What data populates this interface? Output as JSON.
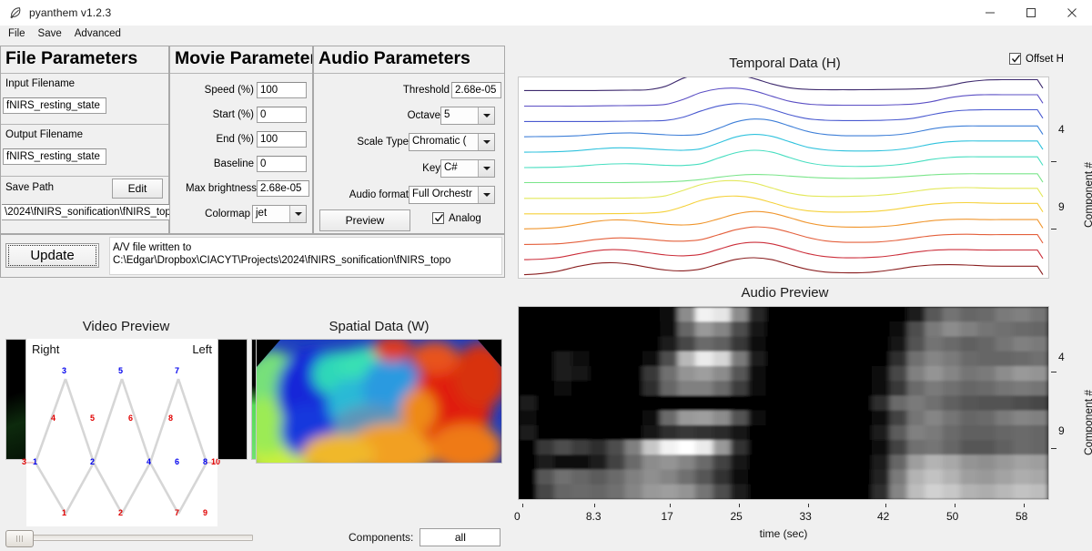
{
  "window": {
    "title": "pyanthem v1.2.3",
    "app_icon": "feather-icon",
    "minimize": "minimize-icon",
    "maximize": "maximize-icon",
    "close": "close-icon"
  },
  "menubar": {
    "items": [
      "File",
      "Save",
      "Advanced"
    ]
  },
  "file_parameters": {
    "header": "File Parameters",
    "input_filename_label": "Input Filename",
    "input_filename_value": "fNIRS_resting_state",
    "output_filename_label": "Output Filename",
    "output_filename_value": "fNIRS_resting_state",
    "save_path_label": "Save Path",
    "edit_button": "Edit",
    "save_path_value": "\\2024\\fNIRS_sonification\\fNIRS_topo"
  },
  "movie_parameters": {
    "header": "Movie Parameters",
    "rows": [
      {
        "label": "Speed (%)",
        "value": "100"
      },
      {
        "label": "Start (%)",
        "value": "0"
      },
      {
        "label": "End (%)",
        "value": "100"
      },
      {
        "label": "Baseline",
        "value": "0"
      },
      {
        "label": "Max brightness",
        "value": "2.68e-05"
      }
    ],
    "colormap_label": "Colormap",
    "colormap_value": "jet"
  },
  "audio_parameters": {
    "header": "Audio Parameters",
    "threshold_label": "Threshold",
    "threshold_value": "2.68e-05",
    "octave_label": "Octave",
    "octave_value": "5",
    "scale_type_label": "Scale Type",
    "scale_type_value": "Chromatic (",
    "key_label": "Key",
    "key_value": "C#",
    "audio_format_label": "Audio format",
    "audio_format_value": "Full Orchestr",
    "preview_button": "Preview",
    "analog_label": "Analog",
    "analog_checked": true
  },
  "action_bar": {
    "update_button": "Update",
    "status_line1": "A/V file written to",
    "status_line2": "C:\\Edgar\\Dropbox\\CIACYT\\Projects\\2024\\fNIRS_sonification\\fNIRS_topo"
  },
  "video_preview": {
    "title": "Video Preview",
    "right_label": "Right",
    "left_label": "Left",
    "source_nodes": [
      "1",
      "2",
      "3",
      "4",
      "5",
      "6",
      "7",
      "8"
    ],
    "detector_nodes": [
      "1",
      "2",
      "3",
      "4",
      "5",
      "6",
      "7",
      "8",
      "9",
      "10"
    ],
    "source_color": "#0000ee",
    "detector_color": "#e00000",
    "timeline_value": 0
  },
  "spatial_data": {
    "title": "Spatial Data (W)"
  },
  "components_selector": {
    "label": "Components:",
    "value": "all"
  },
  "temporal_plot": {
    "title": "Temporal Data (H)",
    "offset_label": "Offset H",
    "offset_checked": true
  },
  "audio_plot": {
    "title": "Audio Preview"
  },
  "chart_data": [
    {
      "type": "line",
      "title": "Temporal Data (H)",
      "xlabel": "",
      "ylabel": "Component #",
      "yticks": [
        4,
        9
      ],
      "ylim": [
        1,
        13
      ],
      "grid": false,
      "legend": "none",
      "colormap": "jet",
      "n_series": 13,
      "series": [
        {
          "name": "Component 1",
          "color": "#3e2a6e",
          "values": [
            0.08,
            0.08,
            0.08,
            0.08,
            0.08,
            0.09,
            0.1,
            0.12,
            0.3,
            0.72,
            0.95,
            1.0,
            0.92,
            0.7,
            0.42,
            0.22,
            0.14,
            0.12,
            0.12,
            0.12,
            0.13,
            0.14,
            0.16,
            0.2,
            0.34,
            0.52,
            0.62,
            0.64,
            0.64,
            0.64
          ]
        },
        {
          "name": "Component 2",
          "color": "#5b4fc4",
          "values": [
            0.07,
            0.07,
            0.07,
            0.07,
            0.08,
            0.09,
            0.1,
            0.11,
            0.16,
            0.42,
            0.78,
            0.97,
            1.0,
            0.86,
            0.58,
            0.32,
            0.18,
            0.13,
            0.12,
            0.12,
            0.12,
            0.14,
            0.18,
            0.3,
            0.5,
            0.62,
            0.66,
            0.66,
            0.66,
            0.66
          ]
        },
        {
          "name": "Component 3",
          "color": "#4a5ad0",
          "values": [
            0.07,
            0.07,
            0.07,
            0.07,
            0.07,
            0.08,
            0.09,
            0.1,
            0.13,
            0.3,
            0.62,
            0.88,
            1.0,
            0.94,
            0.7,
            0.42,
            0.22,
            0.14,
            0.12,
            0.12,
            0.13,
            0.16,
            0.24,
            0.42,
            0.58,
            0.66,
            0.68,
            0.68,
            0.68,
            0.68
          ]
        },
        {
          "name": "Component 4",
          "color": "#3e7fd8",
          "values": [
            0.08,
            0.09,
            0.1,
            0.13,
            0.2,
            0.26,
            0.28,
            0.24,
            0.18,
            0.16,
            0.22,
            0.52,
            0.86,
            1.0,
            0.92,
            0.64,
            0.36,
            0.2,
            0.14,
            0.13,
            0.14,
            0.18,
            0.3,
            0.48,
            0.6,
            0.64,
            0.64,
            0.64,
            0.64,
            0.64
          ]
        },
        {
          "name": "Component 5",
          "color": "#2fc2dd",
          "values": [
            0.08,
            0.09,
            0.11,
            0.16,
            0.24,
            0.3,
            0.3,
            0.26,
            0.2,
            0.18,
            0.26,
            0.56,
            0.88,
            1.0,
            0.9,
            0.62,
            0.34,
            0.2,
            0.15,
            0.14,
            0.15,
            0.2,
            0.32,
            0.5,
            0.62,
            0.66,
            0.66,
            0.66,
            0.66,
            0.66
          ]
        },
        {
          "name": "Component 6",
          "color": "#47dec0",
          "values": [
            0.08,
            0.09,
            0.11,
            0.15,
            0.22,
            0.27,
            0.28,
            0.25,
            0.2,
            0.19,
            0.28,
            0.58,
            0.86,
            0.98,
            0.88,
            0.6,
            0.34,
            0.2,
            0.15,
            0.14,
            0.16,
            0.22,
            0.34,
            0.5,
            0.6,
            0.64,
            0.64,
            0.64,
            0.64,
            0.64
          ]
        },
        {
          "name": "Component 7",
          "color": "#7ae58a",
          "values": [
            0.1,
            0.1,
            0.1,
            0.1,
            0.1,
            0.1,
            0.11,
            0.12,
            0.14,
            0.18,
            0.26,
            0.38,
            0.48,
            0.52,
            0.5,
            0.44,
            0.38,
            0.34,
            0.32,
            0.32,
            0.34,
            0.38,
            0.44,
            0.5,
            0.54,
            0.56,
            0.56,
            0.56,
            0.56,
            0.56
          ]
        },
        {
          "name": "Component 8",
          "color": "#e3e85a",
          "values": [
            0.08,
            0.08,
            0.08,
            0.08,
            0.08,
            0.09,
            0.1,
            0.12,
            0.22,
            0.5,
            0.8,
            0.97,
            1.0,
            0.88,
            0.62,
            0.36,
            0.22,
            0.18,
            0.18,
            0.2,
            0.24,
            0.32,
            0.44,
            0.56,
            0.62,
            0.64,
            0.62,
            0.6,
            0.6,
            0.6
          ]
        },
        {
          "name": "Component 9",
          "color": "#f5d13a",
          "values": [
            0.08,
            0.08,
            0.08,
            0.08,
            0.08,
            0.09,
            0.1,
            0.12,
            0.2,
            0.46,
            0.78,
            0.96,
            1.0,
            0.9,
            0.66,
            0.4,
            0.24,
            0.18,
            0.17,
            0.18,
            0.22,
            0.32,
            0.46,
            0.58,
            0.64,
            0.66,
            0.64,
            0.62,
            0.62,
            0.62
          ]
        },
        {
          "name": "Component 10",
          "color": "#f0962e",
          "values": [
            0.1,
            0.12,
            0.18,
            0.32,
            0.48,
            0.56,
            0.54,
            0.44,
            0.34,
            0.3,
            0.38,
            0.62,
            0.88,
            1.0,
            0.92,
            0.68,
            0.42,
            0.26,
            0.2,
            0.19,
            0.21,
            0.28,
            0.4,
            0.52,
            0.58,
            0.6,
            0.58,
            0.58,
            0.58,
            0.58
          ]
        },
        {
          "name": "Component 11",
          "color": "#e4603c",
          "values": [
            0.09,
            0.1,
            0.13,
            0.22,
            0.34,
            0.42,
            0.42,
            0.36,
            0.28,
            0.26,
            0.34,
            0.6,
            0.86,
            1.0,
            0.94,
            0.72,
            0.46,
            0.28,
            0.21,
            0.2,
            0.22,
            0.3,
            0.42,
            0.54,
            0.6,
            0.62,
            0.6,
            0.6,
            0.6,
            0.6
          ]
        },
        {
          "name": "Component 12",
          "color": "#cc2f3b",
          "values": [
            0.1,
            0.13,
            0.22,
            0.4,
            0.56,
            0.62,
            0.58,
            0.46,
            0.34,
            0.3,
            0.38,
            0.64,
            0.9,
            1.0,
            0.92,
            0.68,
            0.42,
            0.26,
            0.2,
            0.2,
            0.24,
            0.34,
            0.48,
            0.58,
            0.62,
            0.62,
            0.6,
            0.6,
            0.6,
            0.6
          ]
        },
        {
          "name": "Component 13",
          "color": "#8a1f20",
          "values": [
            0.12,
            0.18,
            0.32,
            0.54,
            0.7,
            0.74,
            0.66,
            0.5,
            0.36,
            0.32,
            0.42,
            0.68,
            0.92,
            1.0,
            0.9,
            0.64,
            0.4,
            0.26,
            0.22,
            0.22,
            0.28,
            0.4,
            0.54,
            0.62,
            0.64,
            0.62,
            0.58,
            0.56,
            0.56,
            0.56
          ]
        }
      ]
    },
    {
      "type": "heatmap",
      "title": "Audio Preview",
      "xlabel": "time (sec)",
      "ylabel": "Component #",
      "xticks": [
        "0",
        "8.3",
        "17",
        "25",
        "33",
        "42",
        "50",
        "58"
      ],
      "xtick_positions": [
        0,
        8.3,
        17,
        25,
        33,
        42,
        50,
        58
      ],
      "yticks": [
        4,
        9
      ],
      "xlim": [
        0,
        60
      ],
      "ylim": [
        1,
        13
      ],
      "colormap": "gray",
      "rows": 13,
      "cols": 30,
      "matrix": [
        [
          0,
          0,
          0,
          0,
          0,
          0,
          0,
          0,
          0.05,
          0.55,
          0.95,
          0.9,
          0.55,
          0.15,
          0.02,
          0,
          0,
          0,
          0,
          0,
          0,
          0,
          0.1,
          0.35,
          0.45,
          0.4,
          0.42,
          0.48,
          0.5,
          0.46
        ],
        [
          0,
          0,
          0,
          0,
          0,
          0,
          0,
          0,
          0.04,
          0.4,
          0.6,
          0.52,
          0.3,
          0.08,
          0,
          0,
          0,
          0,
          0,
          0,
          0,
          0.05,
          0.3,
          0.48,
          0.55,
          0.5,
          0.46,
          0.44,
          0.42,
          0.4
        ],
        [
          0,
          0,
          0,
          0,
          0,
          0,
          0,
          0.02,
          0.1,
          0.28,
          0.42,
          0.38,
          0.22,
          0.05,
          0,
          0,
          0,
          0,
          0,
          0,
          0,
          0.08,
          0.32,
          0.45,
          0.42,
          0.38,
          0.4,
          0.46,
          0.5,
          0.48
        ],
        [
          0,
          0,
          0.1,
          0.05,
          0,
          0,
          0,
          0.05,
          0.3,
          0.72,
          0.92,
          0.84,
          0.48,
          0.1,
          0,
          0,
          0,
          0,
          0,
          0,
          0.02,
          0.18,
          0.44,
          0.52,
          0.48,
          0.42,
          0.4,
          0.4,
          0.42,
          0.44
        ],
        [
          0,
          0,
          0.12,
          0.08,
          0,
          0,
          0,
          0.22,
          0.44,
          0.58,
          0.62,
          0.55,
          0.34,
          0.06,
          0,
          0,
          0,
          0,
          0,
          0,
          0.05,
          0.28,
          0.5,
          0.58,
          0.52,
          0.46,
          0.48,
          0.55,
          0.6,
          0.58
        ],
        [
          0,
          0,
          0.05,
          0,
          0,
          0,
          0,
          0.18,
          0.4,
          0.5,
          0.5,
          0.42,
          0.24,
          0.04,
          0,
          0,
          0,
          0,
          0,
          0,
          0.04,
          0.22,
          0.42,
          0.48,
          0.44,
          0.4,
          0.42,
          0.46,
          0.48,
          0.46
        ],
        [
          0.12,
          0,
          0,
          0,
          0,
          0,
          0,
          0,
          0,
          0,
          0,
          0,
          0,
          0,
          0,
          0,
          0,
          0,
          0,
          0,
          0.18,
          0.42,
          0.48,
          0.44,
          0.38,
          0.34,
          0.32,
          0.32,
          0.3,
          0.28
        ],
        [
          0.05,
          0,
          0,
          0,
          0,
          0,
          0,
          0.05,
          0.42,
          0.6,
          0.62,
          0.55,
          0.32,
          0.06,
          0,
          0,
          0,
          0,
          0,
          0,
          0.06,
          0.26,
          0.46,
          0.52,
          0.46,
          0.4,
          0.42,
          0.48,
          0.52,
          0.5
        ],
        [
          0.1,
          0,
          0,
          0,
          0,
          0,
          0,
          0.08,
          0.18,
          0.22,
          0.2,
          0.16,
          0.08,
          0.02,
          0,
          0,
          0,
          0,
          0,
          0,
          0.12,
          0.36,
          0.5,
          0.48,
          0.42,
          0.38,
          0.38,
          0.4,
          0.42,
          0.4
        ],
        [
          0,
          0.22,
          0.3,
          0.24,
          0.18,
          0.3,
          0.5,
          0.78,
          0.95,
          1.0,
          0.92,
          0.6,
          0.2,
          0.02,
          0,
          0,
          0,
          0,
          0,
          0,
          0.05,
          0.26,
          0.44,
          0.46,
          0.4,
          0.34,
          0.34,
          0.38,
          0.42,
          0.4
        ],
        [
          0,
          0.1,
          0.06,
          0.04,
          0.1,
          0.26,
          0.42,
          0.55,
          0.58,
          0.52,
          0.42,
          0.26,
          0.08,
          0,
          0,
          0,
          0,
          0,
          0,
          0,
          0.1,
          0.4,
          0.62,
          0.7,
          0.66,
          0.58,
          0.56,
          0.6,
          0.64,
          0.62
        ],
        [
          0,
          0.34,
          0.44,
          0.4,
          0.36,
          0.42,
          0.5,
          0.56,
          0.52,
          0.44,
          0.34,
          0.2,
          0.06,
          0,
          0,
          0,
          0,
          0,
          0,
          0,
          0.14,
          0.48,
          0.7,
          0.76,
          0.7,
          0.62,
          0.6,
          0.64,
          0.68,
          0.66
        ],
        [
          0,
          0.28,
          0.4,
          0.42,
          0.4,
          0.44,
          0.52,
          0.6,
          0.62,
          0.58,
          0.46,
          0.3,
          0.1,
          0,
          0,
          0,
          0,
          0,
          0,
          0,
          0.18,
          0.52,
          0.74,
          0.82,
          0.78,
          0.7,
          0.68,
          0.72,
          0.76,
          0.74
        ]
      ]
    }
  ]
}
